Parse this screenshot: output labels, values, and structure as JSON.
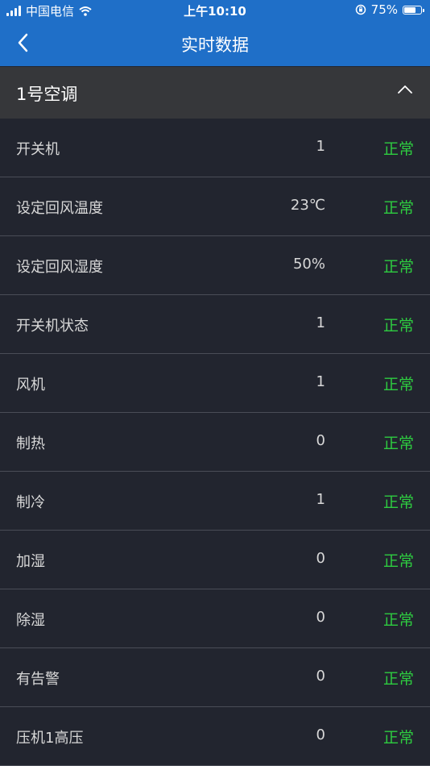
{
  "status_bar": {
    "carrier": "中国电信",
    "time": "上午10:10",
    "battery": "75%",
    "battery_level": 0.75
  },
  "nav": {
    "title": "实时数据",
    "back_icon": "chevron-left-icon"
  },
  "group": {
    "title": "1号空调",
    "toggle_icon": "chevron-up-icon"
  },
  "colors": {
    "header_blue": "#1f6fc8",
    "background": "#22252f",
    "group_header": "#36373a",
    "status_green": "#2ecc40"
  },
  "rows": [
    {
      "label": "开关机",
      "value": "1",
      "status": "正常"
    },
    {
      "label": "设定回风温度",
      "value": "23℃",
      "status": "正常"
    },
    {
      "label": "设定回风湿度",
      "value": "50%",
      "status": "正常"
    },
    {
      "label": "开关机状态",
      "value": "1",
      "status": "正常"
    },
    {
      "label": "风机",
      "value": "1",
      "status": "正常"
    },
    {
      "label": "制热",
      "value": "0",
      "status": "正常"
    },
    {
      "label": "制冷",
      "value": "1",
      "status": "正常"
    },
    {
      "label": "加湿",
      "value": "0",
      "status": "正常"
    },
    {
      "label": "除湿",
      "value": "0",
      "status": "正常"
    },
    {
      "label": "有告警",
      "value": "0",
      "status": "正常"
    },
    {
      "label": "压机1高压",
      "value": "0",
      "status": "正常"
    }
  ]
}
